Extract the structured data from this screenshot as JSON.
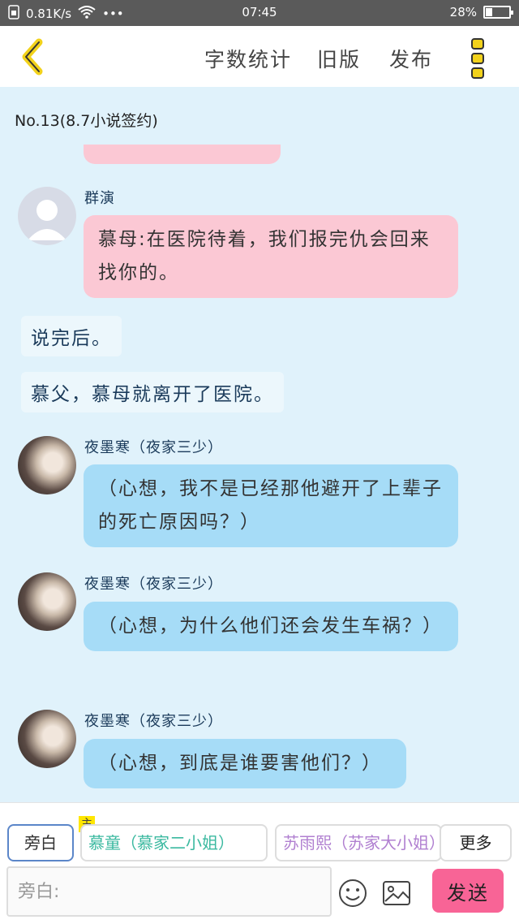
{
  "status_bar": {
    "speed": "0.81K/s",
    "time": "07:45",
    "battery": "28%",
    "battery_level": 0.28
  },
  "header": {
    "back_icon": "chevron-left-icon",
    "word_count": "字数统计",
    "old_version": "旧版",
    "publish": "发布",
    "menu_icon": "three-dots-vertical-icon"
  },
  "doc_title": "No.13(8.7小说签约)",
  "messages": [
    {
      "sender": "群演",
      "avatar": "default",
      "text": "慕母:在医院待着，我们报完仇会回来找你的。",
      "color": "pink"
    },
    {
      "narration": "说完后。"
    },
    {
      "narration": "慕父，慕母就离开了医院。"
    },
    {
      "sender": "夜墨寒（夜家三少）",
      "avatar": "photo",
      "text": "（心想，我不是已经那他避开了上辈子的死亡原因吗？）",
      "color": "blue"
    },
    {
      "sender": "夜墨寒（夜家三少）",
      "avatar": "photo",
      "text": "（心想，为什么他们还会发生车祸？）",
      "color": "blue"
    },
    {
      "sender": "夜墨寒（夜家三少）",
      "avatar": "photo",
      "text": "（心想，到底是谁要害他们？）",
      "color": "blue"
    }
  ],
  "roles": {
    "narrator": "旁白",
    "main_badge": "主",
    "role1": "慕童（慕家二小姐）",
    "role1_color": "#3bb9a0",
    "role2": "苏雨熙（苏家大小姐）",
    "role2_color": "#b07fd0",
    "more": "更多"
  },
  "input": {
    "placeholder": "旁白:"
  },
  "send_label": "发送",
  "colors": {
    "bg": "#e0f2fb",
    "pink_bubble": "#fbc8d4",
    "blue_bubble": "#a6dcf7",
    "send": "#f86496",
    "accent_yellow": "#ffe600"
  }
}
